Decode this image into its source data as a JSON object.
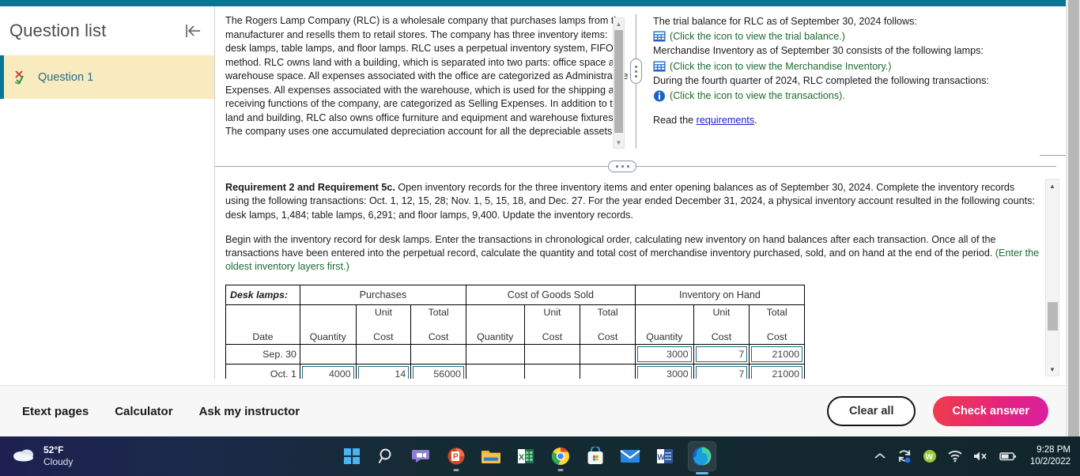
{
  "theme": {
    "teal": "#0a7695",
    "highlight_bg": "#f7ebbf",
    "link_blue": "#2b6a8f",
    "green_text": "#1d6b2f",
    "check_answer_gradient_start": "#ee3d4a",
    "check_answer_gradient_end": "#d81fa0",
    "input_border": "#1b6f85"
  },
  "sidebar": {
    "title": "Question list",
    "collapse_icon": "collapse-left-icon",
    "items": [
      {
        "label": "Question 1",
        "icon": "x-check-icon",
        "selected": true
      }
    ]
  },
  "problem": {
    "left_panel": {
      "text": "The Rogers Lamp Company (RLC) is a wholesale company that purchases lamps from the manufacturer and resells them to retail stores. The company has three inventory items: desk lamps, table lamps, and floor lamps. RLC uses a perpetual inventory system, FIFO method. RLC owns land with a building, which is separated into two parts: office space and warehouse space. All expenses associated with the office are categorized as Administrative Expenses. All expenses associated with the warehouse, which is used for the shipping and receiving functions of the company, are categorized as Selling Expenses. In addition to the land and building, RLC also owns office furniture and equipment and warehouse fixtures. The company uses one accumulated depreciation account for all the depreciable assets."
    },
    "right_panel": {
      "lines": [
        {
          "type": "text",
          "text": "The trial balance for RLC as of September 30, 2024 follows:"
        },
        {
          "type": "click",
          "icon": "table-grid-icon",
          "text": "(Click the icon to view the trial balance.)"
        },
        {
          "type": "text",
          "text": "Merchandise Inventory as of September 30 consists of the following lamps:"
        },
        {
          "type": "click",
          "icon": "table-grid-icon",
          "text": "(Click the icon to view the Merchandise Inventory.)"
        },
        {
          "type": "text",
          "text": "During the fourth quarter of 2024, RLC completed the following transactions:"
        },
        {
          "type": "click",
          "icon": "info-circle-icon",
          "text": "(Click the icon to view the transactions)."
        }
      ],
      "read_prefix": "Read the ",
      "read_link": "requirements",
      "read_suffix": "."
    }
  },
  "requirement": {
    "heading": "Requirement 2 and Requirement 5c.",
    "paragraph1": " Open inventory records for the three inventory items and enter opening balances as of September 30, 2024. Complete the inventory records using the following transactions: Oct. 1, 12, 15, 28; Nov. 1, 5, 15, 18, and Dec. 27. For the year ended December 31, 2024, a physical inventory account resulted in the following counts: desk lamps, 1,484; table lamps, 6,291; and floor lamps, 9,400. Update the inventory records.",
    "paragraph2": "Begin with the inventory record for desk lamps. Enter the transactions in chronological order, calculating new inventory on hand balances after each transaction. Once all of the transactions have been entered into the perpetual record, calculate the quantity and total cost of merchandise inventory purchased, sold, and on hand at the end of the period. ",
    "paragraph2_green": "(Enter the oldest inventory layers first.)"
  },
  "inventory_table": {
    "row_label": "Desk lamps:",
    "group_headers": [
      "Purchases",
      "Cost of Goods Sold",
      "Inventory on Hand"
    ],
    "sub_headers_top": [
      "",
      "",
      "Unit",
      "Total",
      "",
      "Unit",
      "Total",
      "",
      "Unit",
      "Total"
    ],
    "sub_headers_bottom": [
      "Date",
      "Quantity",
      "Cost",
      "Cost",
      "Quantity",
      "Cost",
      "Cost",
      "Quantity",
      "Cost",
      "Cost"
    ],
    "rows": [
      {
        "date": "Sep. 30",
        "purchases": {
          "quantity": "",
          "unit_cost": "",
          "total_cost": "",
          "editable": false
        },
        "cogs": {
          "quantity": "",
          "unit_cost": "",
          "total_cost": "",
          "editable": false
        },
        "on_hand": {
          "quantity": "3000",
          "unit_cost": "7",
          "total_cost": "21000",
          "editable": true
        }
      },
      {
        "date": "Oct. 1",
        "purchases": {
          "quantity": "4000",
          "unit_cost": "14",
          "total_cost": "56000",
          "editable": true
        },
        "cogs": {
          "quantity": "",
          "unit_cost": "",
          "total_cost": "",
          "editable": false
        },
        "on_hand": {
          "quantity": "3000",
          "unit_cost": "7",
          "total_cost": "21000",
          "editable": true
        }
      }
    ]
  },
  "actionbar": {
    "links": [
      "Etext pages",
      "Calculator",
      "Ask my instructor"
    ],
    "clear_label": "Clear all",
    "check_label": "Check answer"
  },
  "taskbar": {
    "weather": {
      "temp": "52°F",
      "desc": "Cloudy",
      "icon": "cloud-icon"
    },
    "apps": [
      {
        "name": "start-windows-icon",
        "running": false,
        "active": false
      },
      {
        "name": "search-icon",
        "running": false,
        "active": false
      },
      {
        "name": "teams-icon",
        "running": false,
        "active": false
      },
      {
        "name": "powerpoint-icon",
        "running": true,
        "active": false
      },
      {
        "name": "file-explorer-icon",
        "running": false,
        "active": false
      },
      {
        "name": "excel-icon",
        "running": false,
        "active": false
      },
      {
        "name": "chrome-icon",
        "running": true,
        "active": false
      },
      {
        "name": "microsoft-store-icon",
        "running": false,
        "active": false
      },
      {
        "name": "mail-icon",
        "running": false,
        "active": false
      },
      {
        "name": "word-icon",
        "running": false,
        "active": false
      },
      {
        "name": "edge-icon",
        "running": true,
        "active": true
      }
    ],
    "tray": [
      {
        "name": "show-hidden-icons-chevron"
      },
      {
        "name": "onedrive-sync-icon"
      },
      {
        "name": "webroot-icon"
      },
      {
        "name": "wifi-icon"
      },
      {
        "name": "volume-muted-icon"
      },
      {
        "name": "battery-icon"
      }
    ],
    "clock": {
      "time": "9:28 PM",
      "date": "10/2/2022"
    }
  }
}
